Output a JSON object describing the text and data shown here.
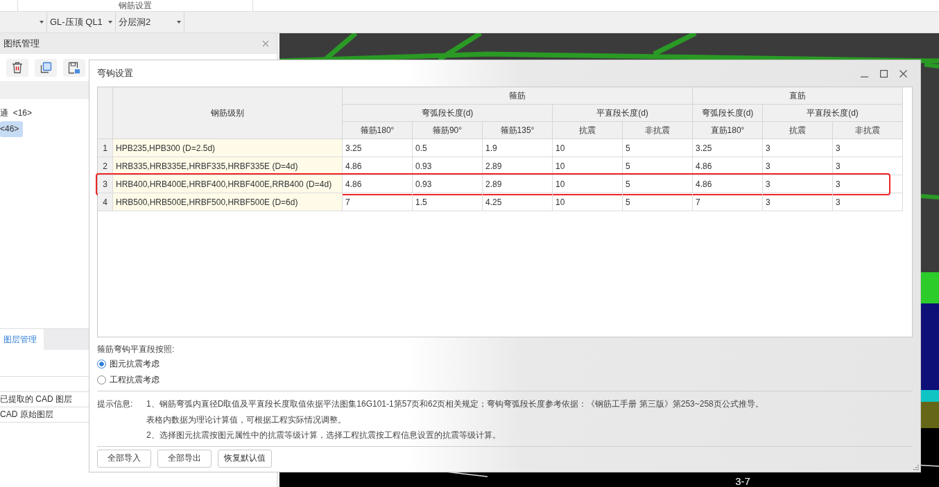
{
  "top_bar": {
    "title": "钢筋设置"
  },
  "toolbar": {
    "dropdowns": [
      {
        "value": "GL-压顶 QL1"
      },
      {
        "value": "分层洞2"
      }
    ]
  },
  "left_panel": {
    "title": "图纸管理",
    "tree": [
      {
        "label": "通  <16>",
        "selected": false
      },
      {
        "label": "<46>",
        "selected": true
      }
    ],
    "tabs": [
      {
        "label": "图层管理",
        "selected": true
      }
    ],
    "layers": [
      {
        "label": "已提取的 CAD 图层"
      },
      {
        "label": "CAD 原始图层"
      }
    ]
  },
  "canvas": {
    "label": "3-7"
  },
  "dialog": {
    "title": "弯钩设置",
    "table": {
      "grade_header": "钢筋级别",
      "groups": [
        {
          "label": "箍筋",
          "subgroups": [
            {
              "label": "弯弧段长度(d)",
              "columns": [
                "箍筋180°",
                "箍筋90°",
                "箍筋135°"
              ]
            },
            {
              "label": "平直段长度(d)",
              "columns": [
                "抗震",
                "非抗震"
              ]
            }
          ]
        },
        {
          "label": "直筋",
          "subgroups": [
            {
              "label": "弯弧段长度(d)",
              "columns": [
                "直筋180°"
              ]
            },
            {
              "label": "平直段长度(d)",
              "columns": [
                "抗震",
                "非抗震"
              ]
            }
          ]
        }
      ],
      "rows": [
        {
          "num": "1",
          "grade": "HPB235,HPB300 (D=2.5d)",
          "values": [
            "3.25",
            "0.5",
            "1.9",
            "10",
            "5",
            "3.25",
            "3",
            "3"
          ],
          "highlighted": false
        },
        {
          "num": "2",
          "grade": "HRB335,HRB335E,HRBF335,HRBF335E (D=4d)",
          "values": [
            "4.86",
            "0.93",
            "2.89",
            "10",
            "5",
            "4.86",
            "3",
            "3"
          ],
          "highlighted": false
        },
        {
          "num": "3",
          "grade": "HRB400,HRB400E,HRBF400,HRBF400E,RRB400 (D=4d)",
          "values": [
            "4.86",
            "0.93",
            "2.89",
            "10",
            "5",
            "4.86",
            "3",
            "3"
          ],
          "highlighted": true
        },
        {
          "num": "4",
          "grade": "HRB500,HRB500E,HRBF500,HRBF500E (D=6d)",
          "values": [
            "7",
            "1.5",
            "4.25",
            "10",
            "5",
            "7",
            "3",
            "3"
          ],
          "highlighted": false
        }
      ]
    },
    "option_label": "箍筋弯钩平直段按照:",
    "options": [
      {
        "label": "图元抗震考虑",
        "selected": true
      },
      {
        "label": "工程抗震考虑",
        "selected": false
      }
    ],
    "tips": {
      "label": "提示信息:",
      "lines": [
        "1、钢筋弯弧内直径D取值及平直段长度取值依据平法图集16G101-1第57页和62页相关规定；弯钩弯弧段长度参考依据：《钢筋工手册  第三版》第253~258页公式推导。",
        "表格内数据为理论计算值，可根据工程实际情况调整。",
        "2、选择图元抗震按图元属性中的抗震等级计算，选择工程抗震按工程信息设置的抗震等级计算。"
      ]
    },
    "buttons": [
      "全部导入",
      "全部导出",
      "恢复默认值"
    ]
  }
}
